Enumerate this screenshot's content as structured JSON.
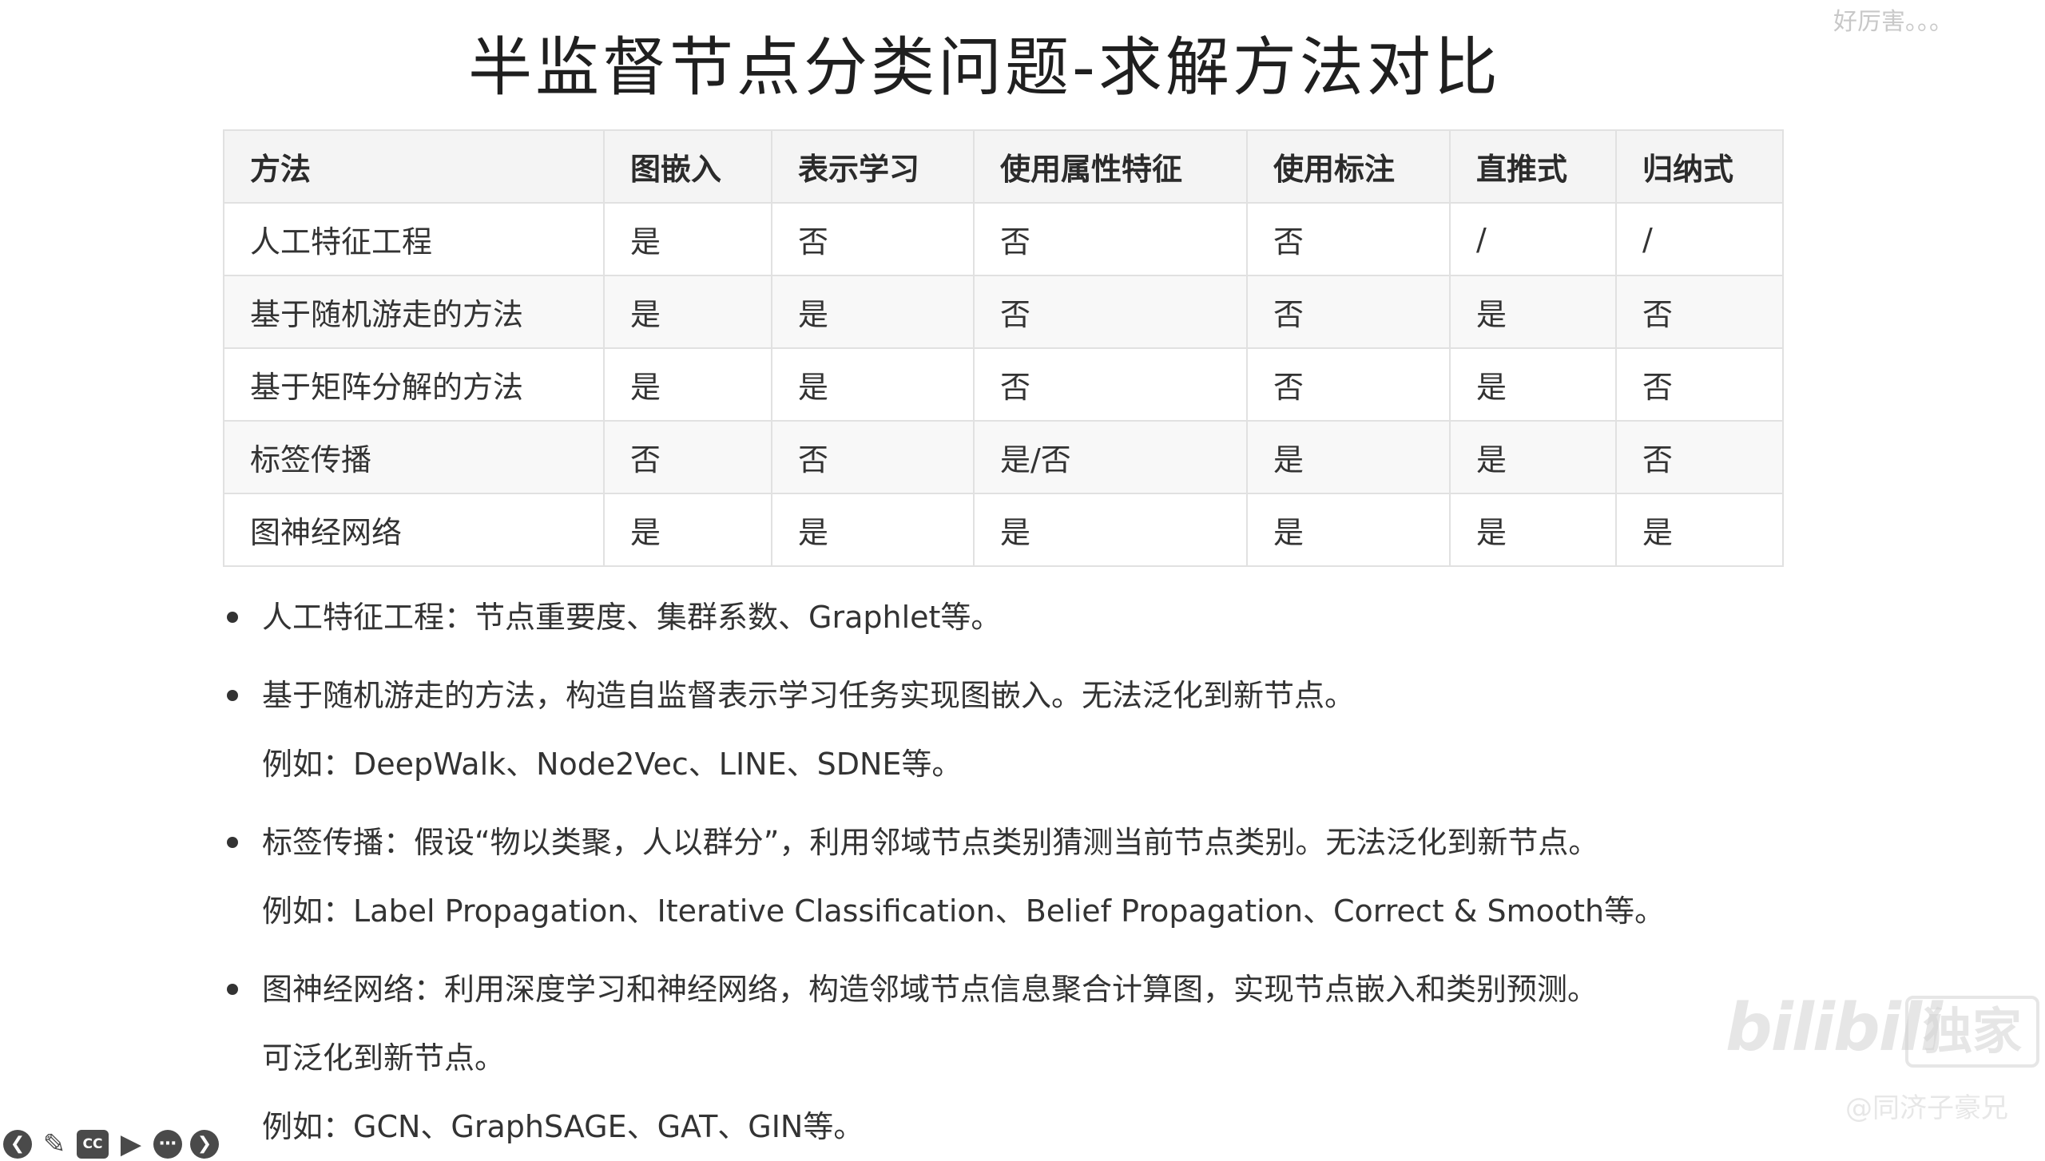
{
  "slide": {
    "title": "半监督节点分类问题-求解方法对比"
  },
  "table": {
    "headers": [
      "方法",
      "图嵌入",
      "表示学习",
      "使用属性特征",
      "使用标注",
      "直推式",
      "归纳式"
    ],
    "rows": [
      [
        "人工特征工程",
        "是",
        "否",
        "否",
        "否",
        "/",
        "/"
      ],
      [
        "基于随机游走的方法",
        "是",
        "是",
        "否",
        "否",
        "是",
        "否"
      ],
      [
        "基于矩阵分解的方法",
        "是",
        "是",
        "否",
        "否",
        "是",
        "否"
      ],
      [
        "标签传播",
        "否",
        "否",
        "是/否",
        "是",
        "是",
        "否"
      ],
      [
        "图神经网络",
        "是",
        "是",
        "是",
        "是",
        "是",
        "是"
      ]
    ]
  },
  "bullets": [
    {
      "lines": [
        "人工特征工程：节点重要度、集群系数、Graphlet等。"
      ]
    },
    {
      "lines": [
        "基于随机游走的方法，构造自监督表示学习任务实现图嵌入。无法泛化到新节点。",
        "例如：DeepWalk、Node2Vec、LINE、SDNE等。"
      ]
    },
    {
      "lines": [
        "标签传播：假设“物以类聚，人以群分”，利用邻域节点类别猜测当前节点类别。无法泛化到新节点。",
        "例如：Label Propagation、Iterative Classification、Belief Propagation、Correct & Smooth等。"
      ]
    },
    {
      "lines": [
        "图神经网络：利用深度学习和神经网络，构造邻域节点信息聚合计算图，实现节点嵌入和类别预测。",
        "可泛化到新节点。",
        "例如：GCN、GraphSAGE、GAT、GIN等。"
      ]
    }
  ],
  "overlay": {
    "top_right_text": "好厉害。。。",
    "bili_logo": "bilibili",
    "bili_exclusive": "独家",
    "bili_author": "@同济子豪兄"
  },
  "player_controls": [
    {
      "name": "prev-slide-button",
      "glyph": "❮"
    },
    {
      "name": "pen-tool-button",
      "glyph": "✎"
    },
    {
      "name": "captions-button",
      "glyph": "CC"
    },
    {
      "name": "camera-toggle-button",
      "glyph": "▶"
    },
    {
      "name": "more-options-button",
      "glyph": "⋯"
    },
    {
      "name": "next-slide-button",
      "glyph": "❯"
    }
  ]
}
